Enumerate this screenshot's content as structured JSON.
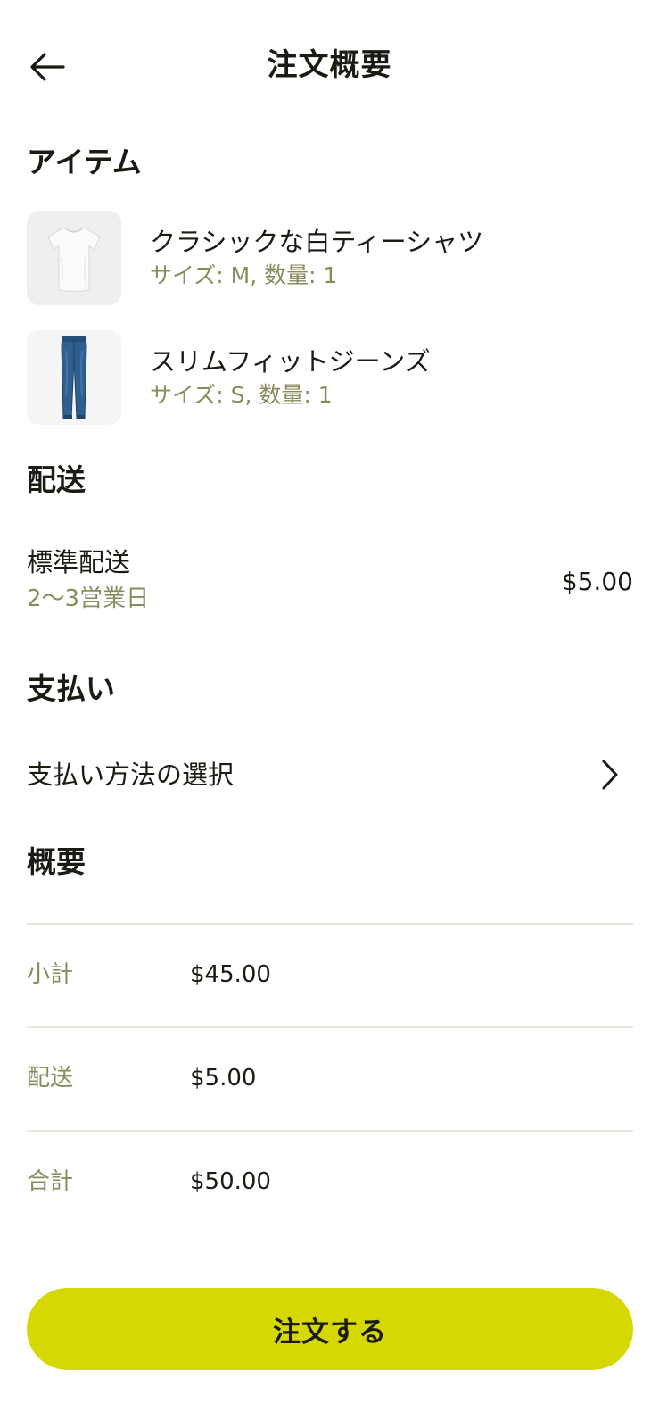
{
  "header": {
    "title": "注文概要",
    "back_icon": "arrow-left-icon"
  },
  "items_section": {
    "title": "アイテム",
    "items": [
      {
        "name": "クラシックな白ティーシャツ",
        "meta": "サイズ: M, 数量: 1",
        "image": "white-tshirt-image"
      },
      {
        "name": "スリムフィットジーンズ",
        "meta": "サイズ: S, 数量: 1",
        "image": "slim-jeans-image"
      }
    ]
  },
  "shipping_section": {
    "title": "配送",
    "method": "標準配送",
    "days": "2〜3営業日",
    "price": "$5.00"
  },
  "payment_section": {
    "title": "支払い",
    "select_label": "支払い方法の選択",
    "chevron_icon": "chevron-right-icon"
  },
  "summary_section": {
    "title": "概要",
    "rows": [
      {
        "label": "小計",
        "value": "$45.00"
      },
      {
        "label": "配送",
        "value": "$5.00"
      },
      {
        "label": "合計",
        "value": "$50.00"
      }
    ]
  },
  "order_button": {
    "label": "注文する",
    "color": "#d6d803"
  },
  "colors": {
    "text": "#1b1b14",
    "muted": "#8a8b5c",
    "divider": "#e6e6d8"
  }
}
